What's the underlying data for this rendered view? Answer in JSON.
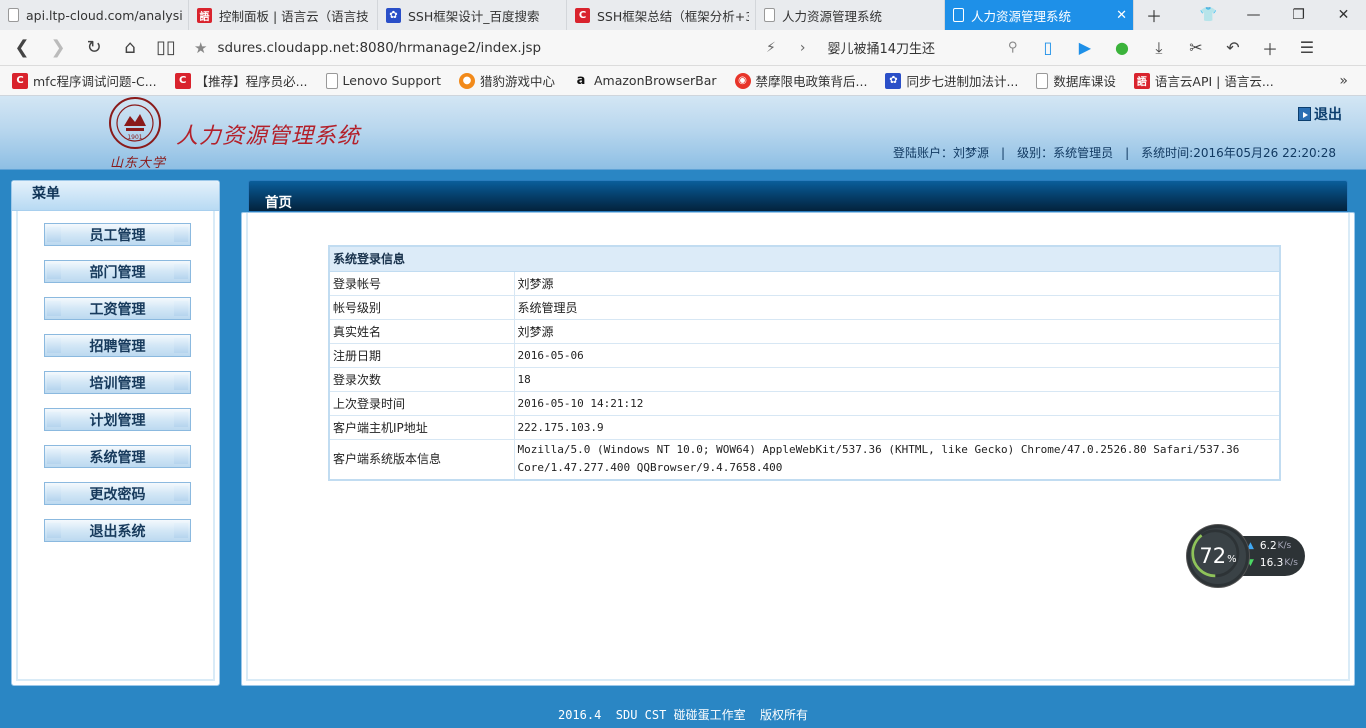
{
  "browser": {
    "tabs": [
      {
        "title": "api.ltp-cloud.com/analysi",
        "icon": "document-icon",
        "active": false
      },
      {
        "title": "控制面板 | 语言云（语言技",
        "icon": "yuyan-icon",
        "active": false
      },
      {
        "title": "SSH框架设计_百度搜索",
        "icon": "baidu-paw-icon",
        "active": false
      },
      {
        "title": "SSH框架总结（框架分析+3",
        "icon": "csdn-icon",
        "active": false
      },
      {
        "title": "人力资源管理系统",
        "icon": "document-icon",
        "active": false
      },
      {
        "title": "人力资源管理系统",
        "icon": "document-icon",
        "active": true
      }
    ],
    "url": "sdures.cloudapp.net:8080/hrmanage2/index.jsp",
    "search_text": "婴儿被捅14刀生还",
    "bookmarks": [
      {
        "label": "mfc程序调试问题-C...",
        "icon": "csdn-icon"
      },
      {
        "label": "【推荐】程序员必...",
        "icon": "csdn-icon"
      },
      {
        "label": "Lenovo Support",
        "icon": "document-icon"
      },
      {
        "label": "猎豹游戏中心",
        "icon": "cheetah-icon"
      },
      {
        "label": "AmazonBrowserBar",
        "icon": "amazon-icon"
      },
      {
        "label": "禁摩限电政策背后...",
        "icon": "weibo-icon"
      },
      {
        "label": "同步七进制加法计...",
        "icon": "baidu-paw-icon"
      },
      {
        "label": "数据库课设",
        "icon": "document-icon"
      },
      {
        "label": "语言云API | 语言云...",
        "icon": "yuyan-icon"
      }
    ]
  },
  "header": {
    "system_title": "人力资源管理系统",
    "logo_year": "1901",
    "logout_label": "退出",
    "account_label": "登陆账户：刘梦源",
    "level_label": "级别：系统管理员",
    "time_label": "系统时间:2016年05月26 22:20:28"
  },
  "sidebar": {
    "title": "菜单",
    "items": [
      {
        "label": "员工管理"
      },
      {
        "label": "部门管理"
      },
      {
        "label": "工资管理"
      },
      {
        "label": "招聘管理"
      },
      {
        "label": "培训管理"
      },
      {
        "label": "计划管理"
      },
      {
        "label": "系统管理"
      },
      {
        "label": "更改密码"
      },
      {
        "label": "退出系统"
      }
    ]
  },
  "main": {
    "tab_title": "首页",
    "table_title": "系统登录信息",
    "rows": [
      {
        "key": "登录帐号",
        "value": "刘梦源"
      },
      {
        "key": "帐号级别",
        "value": "系统管理员"
      },
      {
        "key": "真实姓名",
        "value": "刘梦源"
      },
      {
        "key": "注册日期",
        "value": "2016-05-06"
      },
      {
        "key": "登录次数",
        "value": "18"
      },
      {
        "key": "上次登录时间",
        "value": "2016-05-10 14:21:12"
      },
      {
        "key": "客户端主机IP地址",
        "value": "222.175.103.9"
      },
      {
        "key": "客户端系统版本信息",
        "value_line1": "Mozilla/5.0 (Windows NT 10.0; WOW64) AppleWebKit/537.36 (KHTML, like Gecko) Chrome/47.0.2526.80 Safari/537.36",
        "value_line2": "Core/1.47.277.400 QQBrowser/9.4.7658.400"
      }
    ]
  },
  "footer": {
    "text": "2016.4  SDU CST 碰碰蛋工作室  版权所有"
  },
  "speed_widget": {
    "percent": "72",
    "percent_sign": "%",
    "upload": "6.2",
    "download": "16.3",
    "unit": "K/s"
  }
}
